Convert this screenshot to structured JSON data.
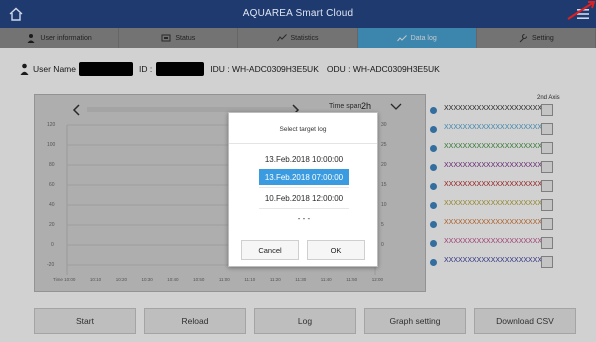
{
  "app": {
    "title": "AQUAREA Smart Cloud"
  },
  "tabs": [
    {
      "label": "User information",
      "active": false
    },
    {
      "label": "Status",
      "active": false
    },
    {
      "label": "Statistics",
      "active": false
    },
    {
      "label": "Data log",
      "active": true
    },
    {
      "label": "Setting",
      "active": false
    }
  ],
  "user": {
    "name_label": "User Name",
    "id_label": "ID :",
    "idu": "IDU : WH-ADC0309H3E5UK",
    "odu": "ODU : WH-ADC0309H3E5UK"
  },
  "graph": {
    "time_span_label": "Time span",
    "time_span_value": "2h",
    "second_axis_label": "2nd Axis",
    "left_ticks": [
      "120",
      "100",
      "80",
      "60",
      "40",
      "20",
      "0",
      "-20"
    ],
    "right_ticks": [
      "30",
      "25",
      "20",
      "15",
      "10",
      "5",
      "0"
    ],
    "x_ticks": [
      "Time 10:00",
      "10:10",
      "10:20",
      "10:30",
      "10:40",
      "10:50",
      "11:00",
      "11:10",
      "11:20",
      "11:30",
      "11:40",
      "11:50",
      "12:00"
    ]
  },
  "legend": [
    {
      "label": "XXXXXXXXXXXXXXXXXXXXX",
      "color": "#2a2a2a"
    },
    {
      "label": "XXXXXXXXXXXXXXXXXXXXX",
      "color": "#4aa3d3"
    },
    {
      "label": "XXXXXXXXXXXXXXXXXXXXX",
      "color": "#3c8f3c"
    },
    {
      "label": "XXXXXXXXXXXXXXXXXXXXX",
      "color": "#7a2a8a"
    },
    {
      "label": "XXXXXXXXXXXXXXXXXXXXX",
      "color": "#b52020"
    },
    {
      "label": "XXXXXXXXXXXXXXXXXXXXX",
      "color": "#b0a032"
    },
    {
      "label": "XXXXXXXXXXXXXXXXXXXXX",
      "color": "#d0702a"
    },
    {
      "label": "XXXXXXXXXXXXXXXXXXXXX",
      "color": "#c24a8a"
    },
    {
      "label": "XXXXXXXXXXXXXXXXXXXXX",
      "color": "#3a3aa0"
    }
  ],
  "bottom_buttons": [
    "Start",
    "Reload",
    "Log",
    "Graph setting",
    "Download CSV"
  ],
  "dialog": {
    "title": "Select target log",
    "options": [
      "13.Feb.2018 10:00:00",
      "13.Feb.2018 07:00:00",
      "10.Feb.2018 12:00:00",
      "- - -"
    ],
    "selected_index": 1,
    "cancel": "Cancel",
    "ok": "OK"
  },
  "colors": {
    "topbar": "#1f3a6e",
    "active_tab": "#4aa3d3",
    "selection": "#3a9be0",
    "annotation_arrow": "#e02020"
  }
}
